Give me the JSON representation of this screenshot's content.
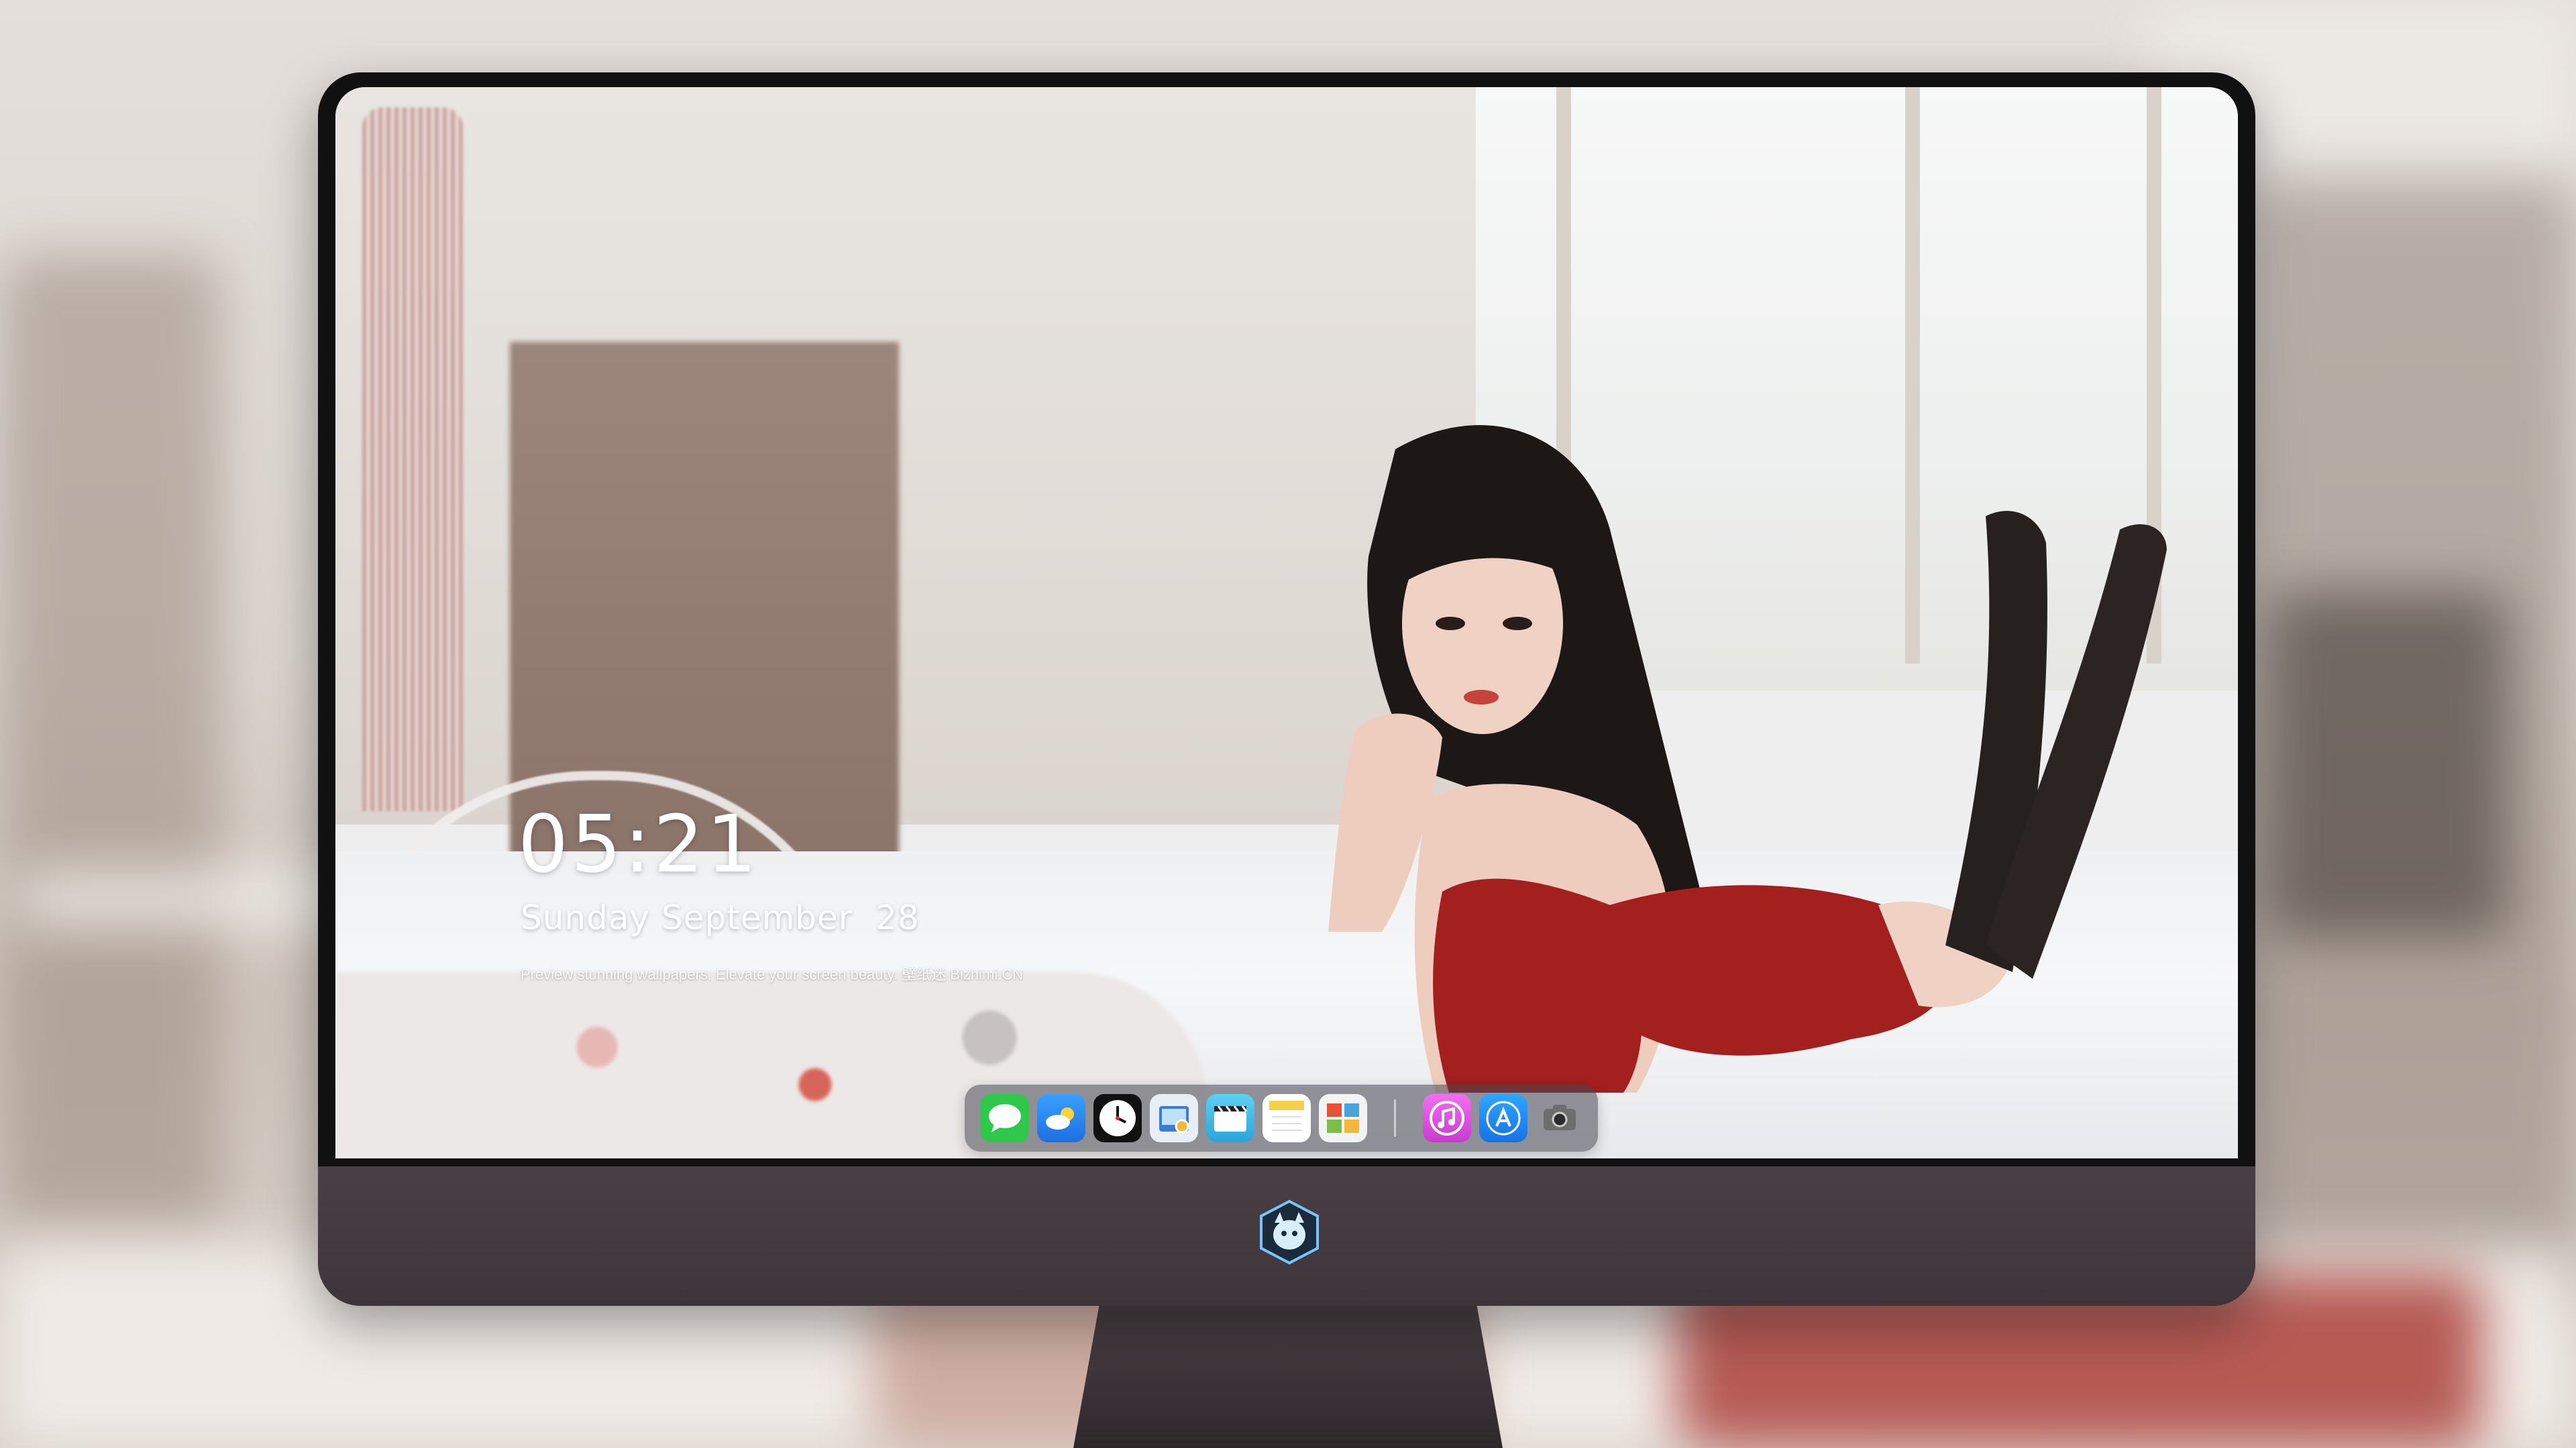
{
  "lockscreen": {
    "time": "05:21",
    "date": "Sunday September  28",
    "tagline": "Preview stunning wallpapers. Elevate your screen beauty. 壁纸迷 Bizhimi.CN"
  },
  "dock": {
    "apps": [
      {
        "name": "messages-icon",
        "color": "#2ec94a"
      },
      {
        "name": "weather-icon",
        "color": "#2a8ff0"
      },
      {
        "name": "clock-icon",
        "color": "#ffffff"
      },
      {
        "name": "preview-icon",
        "color": "#3a7bd5"
      },
      {
        "name": "clips-icon",
        "color": "#39b6e8"
      },
      {
        "name": "notes-icon",
        "color": "#f6d046"
      },
      {
        "name": "photo-booth-icon",
        "color": "#7bbf4a"
      },
      {
        "name": "itunes-icon",
        "color": "#e24fd6"
      },
      {
        "name": "app-store-icon",
        "color": "#1e8ef5"
      },
      {
        "name": "screenshot-icon",
        "color": "#555555"
      }
    ]
  }
}
